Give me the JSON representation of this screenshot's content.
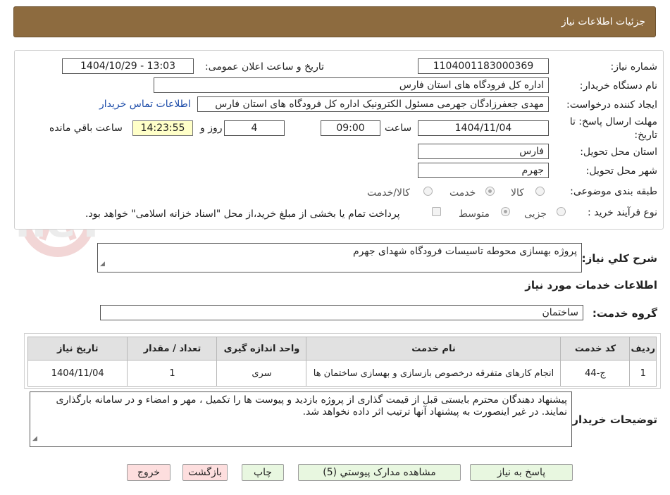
{
  "header": {
    "title": "جزئیات اطلاعات نیاز"
  },
  "watermark": "AriaTender.neT",
  "form": {
    "need_number_label": "شماره نیاز:",
    "need_number": "1104001183000369",
    "announce_label": "تاریخ و ساعت اعلان عمومی:",
    "announce_value": "1404/10/29 - 13:03",
    "buyer_label": "نام دستگاه خریدار:",
    "buyer_value": "اداره کل فرودگاه های استان فارس",
    "creator_label": "ایجاد کننده درخواست:",
    "creator_value": "مهدی جعفرزادگان جهرمی مسئول الکترونیک اداره کل فرودگاه های استان فارس",
    "contact_link": "اطلاعات تماس خریدار",
    "deadline_label_line1": "مهلت ارسال پاسخ: تا",
    "deadline_label_line2": "تاریخ:",
    "deadline_date": "1404/11/04",
    "time_label": "ساعت",
    "deadline_time": "09:00",
    "days_value": "4",
    "days_label": "روز و",
    "remaining_time": "14:23:55",
    "remaining_label": "ساعت باقي مانده",
    "province_label": "استان محل تحویل:",
    "province_value": "فارس",
    "city_label": "شهر محل تحویل:",
    "city_value": "جهرم",
    "category_label": "طبقه بندی موضوعی:",
    "category_options": [
      "کالا",
      "خدمت",
      "کالا/خدمت"
    ],
    "category_selected": "خدمت",
    "process_label": "نوع فرآیند خرید :",
    "process_options": [
      "جزیی",
      "متوسط"
    ],
    "process_selected": "متوسط",
    "payment_note": "پرداخت تمام یا بخشی از مبلغ خرید،از محل \"اسناد خزانه اسلامی\" خواهد بود."
  },
  "summary": {
    "label": "شرح کلي نياز:",
    "value": "پروژه بهسازی محوطه تاسیسات فرودگاه شهدای جهرم"
  },
  "services": {
    "section_title": "اطلاعات خدمات مورد نياز",
    "group_label": "گروه خدمت:",
    "group_value": "ساختمان",
    "columns": [
      "ردیف",
      "کد خدمت",
      "نام خدمت",
      "واحد اندازه گیری",
      "تعداد / مقدار",
      "تاریخ نیاز"
    ],
    "rows": [
      {
        "row": "1",
        "code": "ج-44",
        "name": "انجام کارهای متفرقه درخصوص بازسازی و بهسازی ساختمان ها",
        "unit": "سری",
        "qty": "1",
        "date": "1404/11/04"
      }
    ]
  },
  "buyer_notes": {
    "label": "توضیحات خریدار:",
    "line1": "پیشنهاد دهندگان محترم بایستی قبل از قیمت گذاری از پروژه بازدید و  پیوست ها را تکمیل ، مهر و امضاء و در سامانه بارگذاری",
    "line2": "نمایند. در غیر اینصورت به پیشنهاد آنها ترتیب اثر داده نخواهد شد."
  },
  "buttons": {
    "reply": "پاسخ به نیاز",
    "attachments": "مشاهده مدارک پیوستي (5)",
    "print": "چاپ",
    "back": "بازگشت",
    "exit": "خروج"
  }
}
